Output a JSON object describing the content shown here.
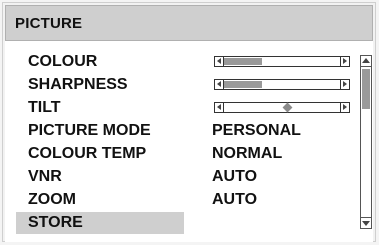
{
  "header": {
    "title": "PICTURE"
  },
  "menu": {
    "items": [
      {
        "label": "COLOUR"
      },
      {
        "label": "SHARPNESS"
      },
      {
        "label": "TILT"
      },
      {
        "label": "PICTURE MODE"
      },
      {
        "label": "COLOUR TEMP"
      },
      {
        "label": "VNR"
      },
      {
        "label": "ZOOM"
      },
      {
        "label": "STORE"
      }
    ],
    "selected_index": 7
  },
  "settings": {
    "colour_level": 0.33,
    "sharpness_level": 0.33,
    "tilt_level": 0.55,
    "picture_mode": "PERSONAL",
    "colour_temp": "NORMAL",
    "vnr": "AUTO",
    "zoom": "AUTO"
  },
  "scrollbar": {
    "position": 0.0,
    "visible_fraction": 0.28
  },
  "colors": {
    "selected_bg": "#cfcfcf",
    "fill": "#9a9a9a",
    "title_bg": "#cfcfcf"
  }
}
